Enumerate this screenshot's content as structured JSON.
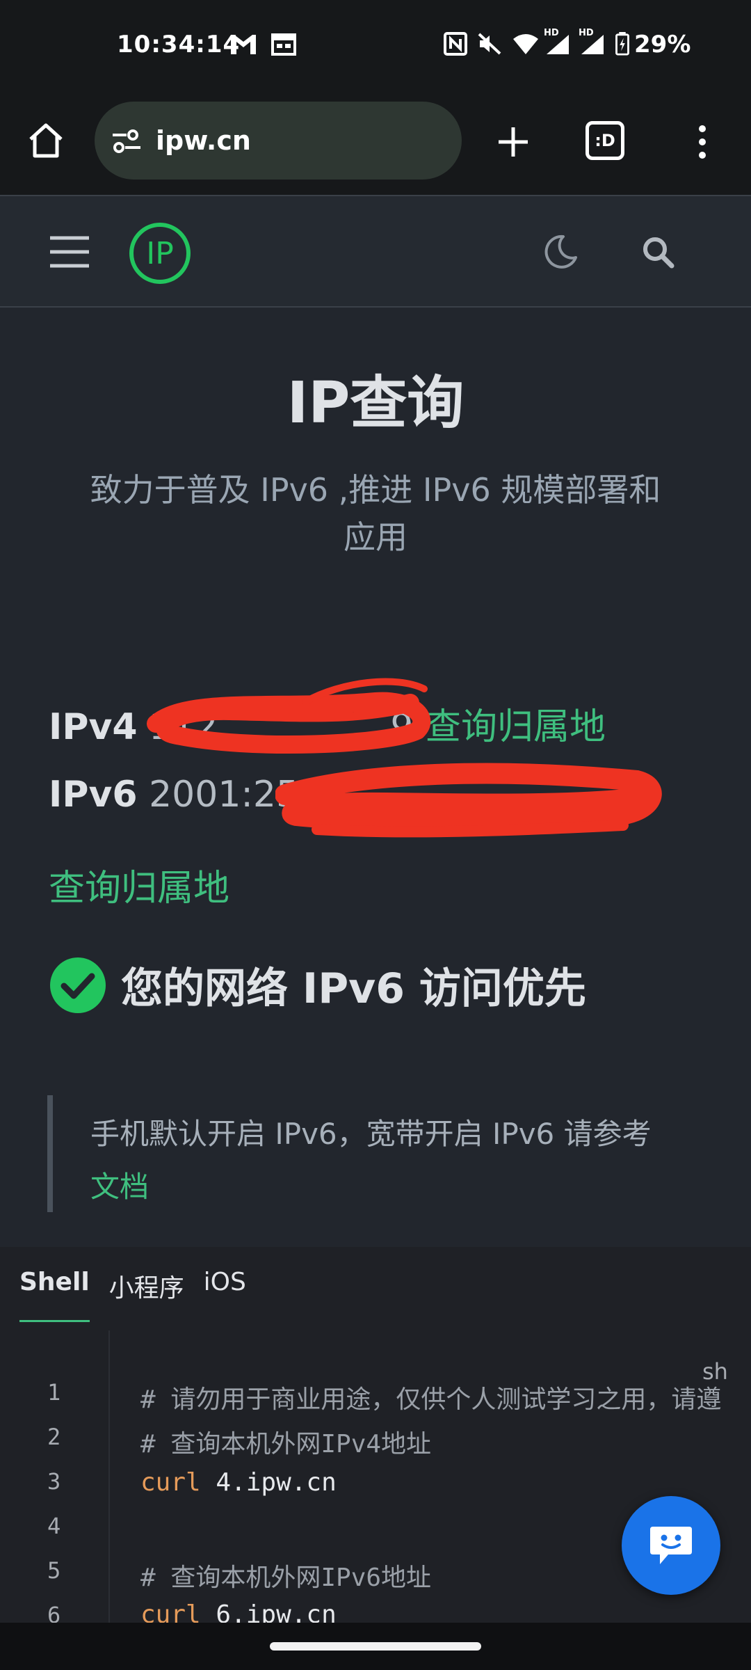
{
  "status_bar": {
    "time": "10:34:14",
    "battery": "29%",
    "hd_label": "HD"
  },
  "browser": {
    "url": "ipw.cn",
    "tab_switcher": ":D"
  },
  "site": {
    "brand": "IP",
    "accent": "#3fbf7f"
  },
  "main": {
    "title": "IP查询",
    "subtitle_line1": "致力于普及 IPv6 ,推进 IPv6 规模部署和",
    "subtitle_line2": "应用",
    "ipv4_label": "IPv4",
    "ipv4_visible": "112",
    "ipv4_suffix": "9",
    "ipv4_link": "查询归属地",
    "ipv6_label": "IPv6",
    "ipv6_visible": "2001:25",
    "ipv6_link": "查询归属地",
    "status": "您的网络 IPv6 访问优先",
    "quote_text": "手机默认开启 IPv6，宽带开启 IPv6 请参考",
    "quote_link": "文档"
  },
  "code_panel": {
    "tabs": [
      "Shell",
      "小程序",
      "iOS"
    ],
    "lang": "sh",
    "line_numbers": [
      "1",
      "2",
      "3",
      "4",
      "5",
      "6"
    ],
    "lines": [
      "# 请勿用于商业用途，仅供个人测试学习之用，请遵",
      "# 查询本机外网IPv4地址",
      "curl 4.ipw.cn",
      "",
      "# 查询本机外网IPv6地址",
      "curl 6.ipw.cn"
    ],
    "cmd": "curl",
    "line3_arg": " 4.ipw.cn",
    "line6_arg": " 6.ipw.cn"
  }
}
